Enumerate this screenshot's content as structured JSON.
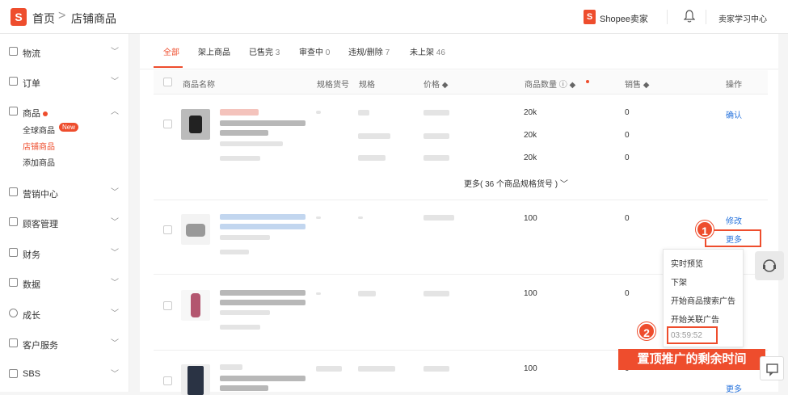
{
  "topbar": {
    "home": "首页",
    "separator": ">",
    "current": "店铺商品",
    "seller_brand": "Shopee卖家",
    "learning_center": "卖家学习中心"
  },
  "sidebar": {
    "items": [
      {
        "label": "物流"
      },
      {
        "label": "订单"
      },
      {
        "label": "商品"
      },
      {
        "label": "营销中心"
      },
      {
        "label": "顾客管理"
      },
      {
        "label": "财务"
      },
      {
        "label": "数据"
      },
      {
        "label": "成长"
      },
      {
        "label": "客户服务"
      },
      {
        "label": "SBS"
      }
    ],
    "sub_items": [
      {
        "label": "全球商品"
      },
      {
        "label": "店铺商品"
      },
      {
        "label": "添加商品"
      }
    ],
    "new_badge": "New"
  },
  "tabs": [
    {
      "label": "全部",
      "count": ""
    },
    {
      "label": "架上商品",
      "count": ""
    },
    {
      "label": "已售完",
      "count": "3"
    },
    {
      "label": "审查中",
      "count": "0"
    },
    {
      "label": "违规/删除",
      "count": "7"
    },
    {
      "label": "未上架",
      "count": "46"
    }
  ],
  "table": {
    "headers": {
      "name": "商品名称",
      "sku": "规格货号",
      "variation": "规格",
      "price": "价格 ◆",
      "stock": "商品数量 ⓘ ◆",
      "sales": "销售 ◆",
      "action": "操作"
    },
    "rows": [
      {
        "stocks": [
          "20k",
          "20k",
          "20k"
        ],
        "sales": [
          "0",
          "0",
          "0"
        ],
        "action": "确认"
      },
      {
        "stocks": [
          "100"
        ],
        "sales": [
          "0"
        ],
        "action": "修改",
        "more": "更多"
      },
      {
        "stocks": [
          "100"
        ],
        "sales": [
          "0"
        ]
      },
      {
        "stocks": [
          "100"
        ],
        "sales": [
          "0"
        ],
        "more": "更多"
      }
    ],
    "more_variations": "更多( 36 个商品规格货号 )"
  },
  "dropdown": {
    "items": [
      "实时预览",
      "下架",
      "开始商品搜索广告",
      "开始关联广告"
    ],
    "timer": "03:59:52"
  },
  "annotations": {
    "badge1": "1",
    "badge2": "2",
    "banner": "置顶推广的剩余时间"
  },
  "colors": {
    "accent": "#ee4d2d",
    "link": "#2673dd"
  }
}
